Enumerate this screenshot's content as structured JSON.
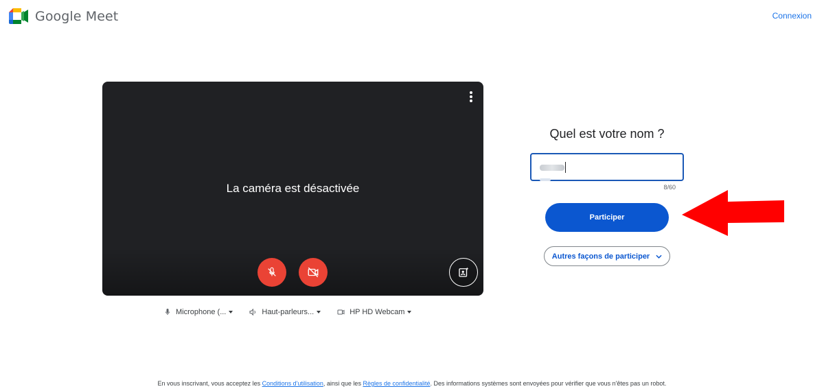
{
  "header": {
    "brand": "Google Meet",
    "sign_in": "Connexion"
  },
  "preview": {
    "camera_off_message": "La caméra est désactivée",
    "more_icon": "more-vert-icon",
    "mic_icon": "mic-off-icon",
    "camera_icon": "videocam-off-icon",
    "effects_icon": "visual-effects-icon",
    "control_color": "#ea4335"
  },
  "devices": [
    {
      "icon": "mic-icon",
      "label": "Microphone (..."
    },
    {
      "icon": "speaker-icon",
      "label": "Haut-parleurs..."
    },
    {
      "icon": "videocam-icon",
      "label": "HP HD Webcam"
    }
  ],
  "join": {
    "title": "Quel est votre nom ?",
    "name_value": "",
    "char_count": "8/60",
    "join_label": "Participer",
    "other_label": "Autres façons de participer",
    "accent": "#0b57d0"
  },
  "annotation": {
    "arrow_color": "#ff0000"
  },
  "footer": {
    "text_before": "En vous inscrivant, vous acceptez les ",
    "terms_link": "Conditions d'utilisation",
    "text_middle": ", ainsi que les ",
    "privacy_link": "Règles de confidentialité",
    "text_after": ". Des informations systèmes sont envoyées pour vérifier que vous n'êtes pas un robot."
  }
}
